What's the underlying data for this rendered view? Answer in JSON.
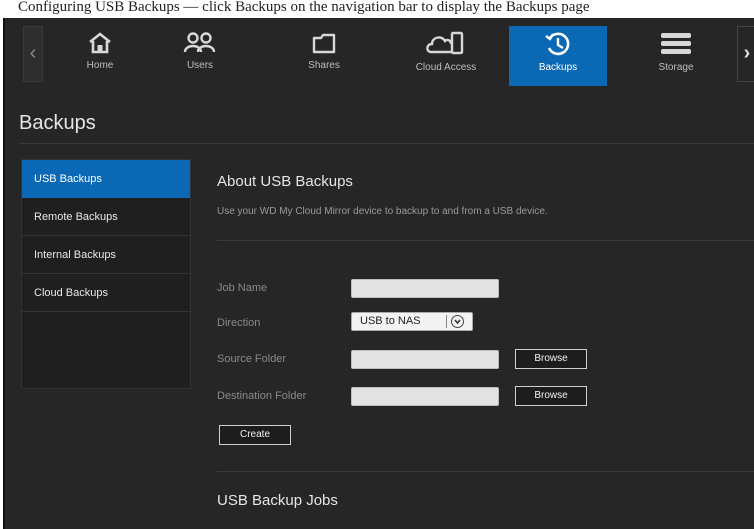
{
  "caption": "Configuring USB Backups — click Backups on the navigation bar to display the Backups page",
  "nav": {
    "items": [
      {
        "label": "Home",
        "icon": "home-icon"
      },
      {
        "label": "Users",
        "icon": "users-icon"
      },
      {
        "label": "Shares",
        "icon": "folder-icon"
      },
      {
        "label": "Cloud Access",
        "icon": "cloud-device-icon"
      },
      {
        "label": "Backups",
        "icon": "backup-clock-icon",
        "active": true
      },
      {
        "label": "Storage",
        "icon": "storage-icon"
      }
    ],
    "left_arrow": "‹",
    "right_arrow": "›"
  },
  "page": {
    "title": "Backups"
  },
  "sidebar": {
    "items": [
      {
        "label": "USB Backups",
        "active": true
      },
      {
        "label": "Remote Backups"
      },
      {
        "label": "Internal Backups"
      },
      {
        "label": "Cloud Backups"
      }
    ]
  },
  "about": {
    "title": "About USB Backups",
    "description": "Use your WD My Cloud Mirror device to backup to and from a USB device."
  },
  "form": {
    "job_name_label": "Job Name",
    "job_name_value": "",
    "direction_label": "Direction",
    "direction_value": "USB to NAS",
    "source_label": "Source Folder",
    "source_value": "",
    "destination_label": "Destination Folder",
    "destination_value": "",
    "browse_label": "Browse",
    "create_label": "Create"
  },
  "jobs": {
    "title": "USB Backup Jobs"
  },
  "colors": {
    "accent": "#0a68b5",
    "background": "#262626"
  }
}
